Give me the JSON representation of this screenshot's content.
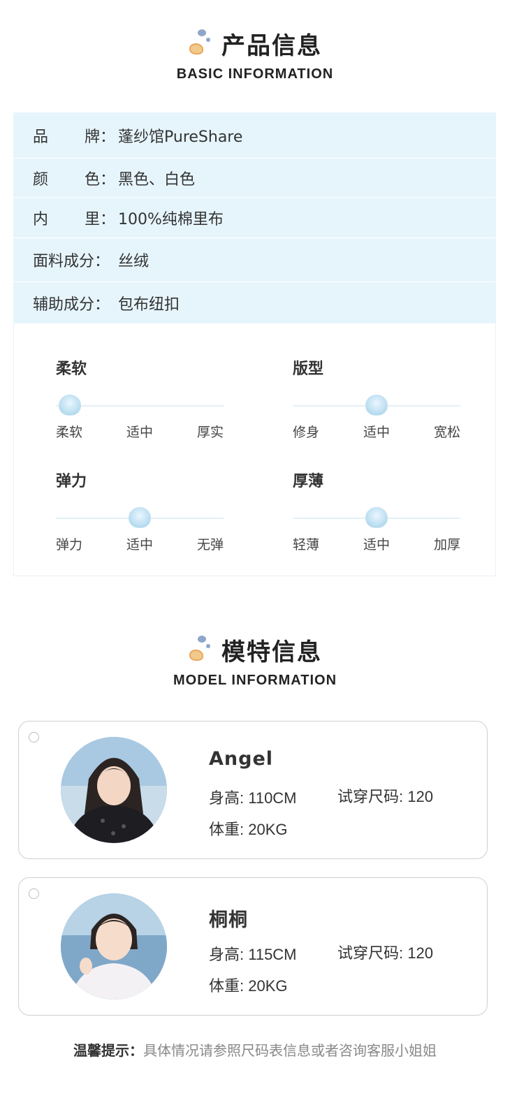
{
  "product_section": {
    "title": "产品信息",
    "subtitle": "BASIC INFORMATION"
  },
  "product_info": [
    {
      "label_chars": [
        "品",
        "牌："
      ],
      "value": "蓬纱馆PureShare"
    },
    {
      "label_chars": [
        "颜",
        "色："
      ],
      "value": "黑色、白色"
    },
    {
      "label_chars": [
        "内",
        "里："
      ],
      "value": "100%纯棉里布"
    },
    {
      "label_chars": [
        "面料成分："
      ],
      "value": "丝绒"
    },
    {
      "label_chars": [
        "辅助成分："
      ],
      "value": "包布纽扣"
    }
  ],
  "meters": [
    {
      "title": "柔软",
      "ticks": [
        "柔软",
        "适中",
        "厚实"
      ],
      "level": 0.0
    },
    {
      "title": "版型",
      "ticks": [
        "修身",
        "适中",
        "宽松"
      ],
      "level": 0.5
    },
    {
      "title": "弹力",
      "ticks": [
        "弹力",
        "适中",
        "无弹"
      ],
      "level": 0.5
    },
    {
      "title": "厚薄",
      "ticks": [
        "轻薄",
        "适中",
        "加厚"
      ],
      "level": 0.5
    }
  ],
  "model_section": {
    "title": "模特信息",
    "subtitle": "MODEL INFORMATION"
  },
  "models": [
    {
      "name": "Angel",
      "height": "身高: 110CM",
      "size": "试穿尺码: 120",
      "weight": "体重: 20KG"
    },
    {
      "name": "桐桐",
      "height": "身高: 115CM",
      "size": "试穿尺码: 120",
      "weight": "体重: 20KG"
    }
  ],
  "tip": {
    "label": "温馨提示：",
    "text": "具体情况请参照尺码表信息或者咨询客服小姐姐"
  },
  "colors": {
    "table_bg": "#e6f5fc",
    "knob": "#bfe0f2"
  }
}
